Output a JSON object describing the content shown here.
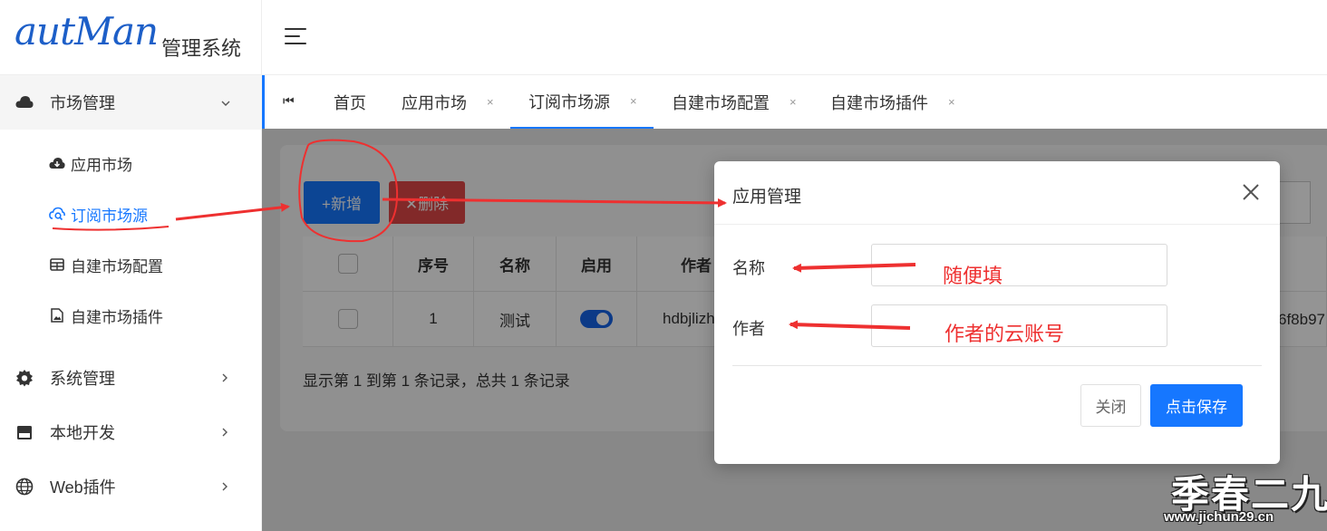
{
  "brand": {
    "script": "autMan",
    "subtitle": "管理系统"
  },
  "sidebar": {
    "groups": [
      {
        "label": "市场管理",
        "icon": "cloud-icon",
        "expanded": true
      },
      {
        "label": "系统管理",
        "icon": "gear-icon",
        "expanded": false
      },
      {
        "label": "本地开发",
        "icon": "calendar-icon",
        "expanded": false
      },
      {
        "label": "Web插件",
        "icon": "globe-icon",
        "expanded": false
      }
    ],
    "items": [
      {
        "label": "应用市场",
        "icon": "cloud-download-icon"
      },
      {
        "label": "订阅市场源",
        "icon": "cloud-search-icon"
      },
      {
        "label": "自建市场配置",
        "icon": "table-icon"
      },
      {
        "label": "自建市场插件",
        "icon": "file-image-icon"
      }
    ]
  },
  "tabs": {
    "first_icon": "⏮",
    "list": [
      {
        "label": "首页",
        "closable": false
      },
      {
        "label": "应用市场",
        "closable": true
      },
      {
        "label": "订阅市场源",
        "closable": true,
        "active": true
      },
      {
        "label": "自建市场配置",
        "closable": true
      },
      {
        "label": "自建市场插件",
        "closable": true
      }
    ],
    "close_glyph": "×"
  },
  "toolbar": {
    "add_label": "+新增",
    "delete_label": "✕删除"
  },
  "table": {
    "headers": [
      "序号",
      "名称",
      "启用",
      "作者"
    ],
    "row": {
      "index": "1",
      "name": "测试",
      "enabled": true,
      "author": "hdbjlizh"
    },
    "tail_value": "6f8b97"
  },
  "pager": {
    "text": "显示第 1 到第 1 条记录，总共 1 条记录"
  },
  "modal": {
    "title": "应用管理",
    "fields": [
      {
        "label": "名称",
        "value": ""
      },
      {
        "label": "作者",
        "value": ""
      }
    ],
    "cancel_label": "关闭",
    "save_label": "点击保存"
  },
  "annotations": {
    "note_name": "随便填",
    "note_author": "作者的云账号"
  },
  "watermark": {
    "main": "季春二九",
    "sub": "www.jichun29.cn"
  },
  "colors": {
    "accent": "#1677ff",
    "danger": "#e04848",
    "annotation": "#ee3030",
    "logo": "#1d5fc8"
  }
}
